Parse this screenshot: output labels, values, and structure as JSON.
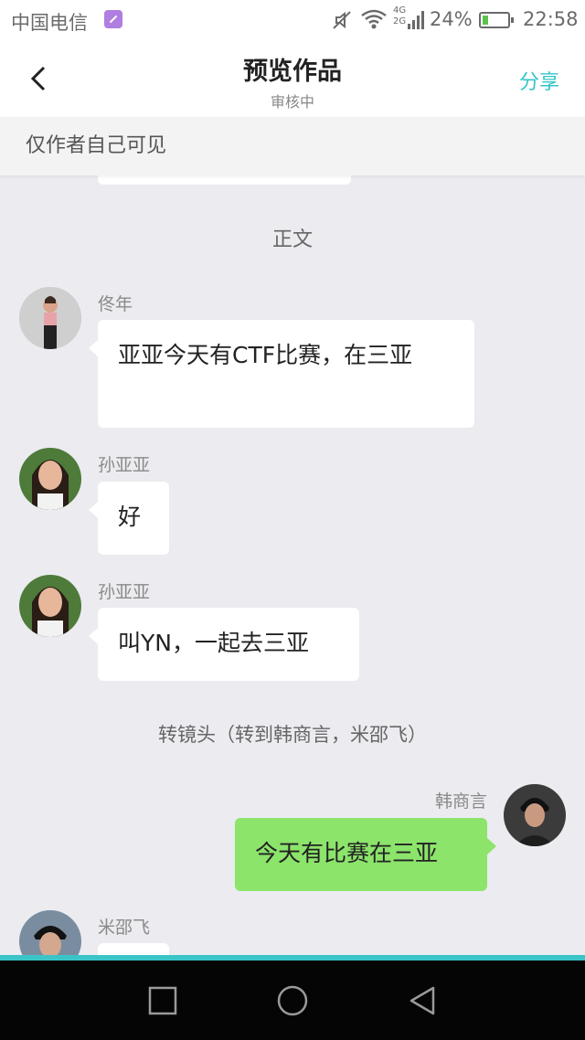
{
  "status_bar": {
    "carrier": "中国电信",
    "network_type_top": "4G",
    "network_type_bottom": "2G",
    "battery": "24%",
    "battery_level": 0.24,
    "time": "22:58",
    "icons": [
      "sim-icon",
      "mute-icon",
      "wifi-icon",
      "signal-icon",
      "battery-icon"
    ]
  },
  "header": {
    "title": "预览作品",
    "subtitle": "审核中",
    "share_label": "分享",
    "back_icon": "chevron-left-icon"
  },
  "banner": {
    "text": "仅作者自己可见"
  },
  "section_label": "正文",
  "messages": [
    {
      "sender": "佟年",
      "text": "亚亚今天有CTF比赛，在三亚",
      "side": "left"
    },
    {
      "sender": "孙亚亚",
      "text": "好",
      "side": "left"
    },
    {
      "sender": "孙亚亚",
      "text": "叫YN，一起去三亚",
      "side": "left"
    },
    {
      "sender": "韩商言",
      "text": "今天有比赛在三亚",
      "side": "right"
    },
    {
      "sender": "米邵飞",
      "text": "",
      "side": "left"
    }
  ],
  "narration": "转镜头（转到韩商言，米邵飞）",
  "colors": {
    "accent": "#36c5c8",
    "right_bubble": "#8ce46b",
    "background": "#ebebf0"
  },
  "navbar": {
    "icons": [
      "square-icon",
      "circle-icon",
      "triangle-back-icon"
    ]
  }
}
